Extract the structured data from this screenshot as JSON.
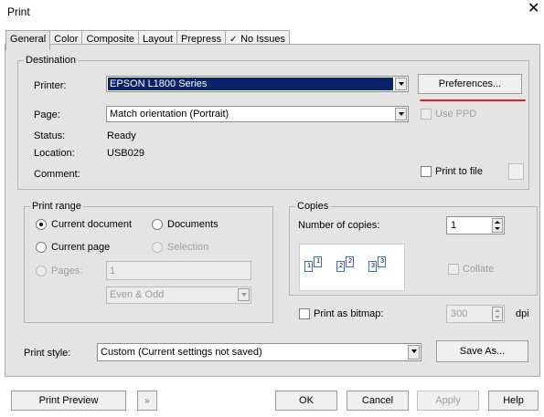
{
  "window": {
    "title": "Print"
  },
  "tabs": [
    "General",
    "Color",
    "Composite",
    "Layout",
    "Prepress",
    "No Issues"
  ],
  "destination": {
    "group_label": "Destination",
    "printer_label": "Printer:",
    "printer_value": "EPSON L1800 Series",
    "preferences_button": "Preferences...",
    "page_label": "Page:",
    "page_value": "Match orientation (Portrait)",
    "use_ppd_label": "Use PPD",
    "status_label": "Status:",
    "status_value": "Ready",
    "location_label": "Location:",
    "location_value": "USB029",
    "comment_label": "Comment:",
    "print_to_file_label": "Print to file"
  },
  "print_range": {
    "group_label": "Print range",
    "current_document": "Current document",
    "documents": "Documents",
    "current_page": "Current page",
    "selection": "Selection",
    "pages_label": "Pages:",
    "pages_value": "1",
    "odd_even_value": "Even & Odd"
  },
  "copies": {
    "group_label": "Copies",
    "number_label": "Number of copies:",
    "number_value": "1",
    "collate_label": "Collate",
    "pages_icons": [
      "1",
      "1",
      "2",
      "2",
      "3",
      "3"
    ]
  },
  "bitmap": {
    "label": "Print as bitmap:",
    "dpi_value": "300",
    "dpi_unit": "dpi"
  },
  "print_style": {
    "label": "Print style:",
    "value": "Custom (Current settings not saved)",
    "save_as_button": "Save As..."
  },
  "footer": {
    "print_preview": "Print Preview",
    "ok": "OK",
    "cancel": "Cancel",
    "apply": "Apply",
    "help": "Help"
  },
  "colors": {
    "selection_highlight": "#0a246a",
    "annotation_underline": "#e02020"
  }
}
